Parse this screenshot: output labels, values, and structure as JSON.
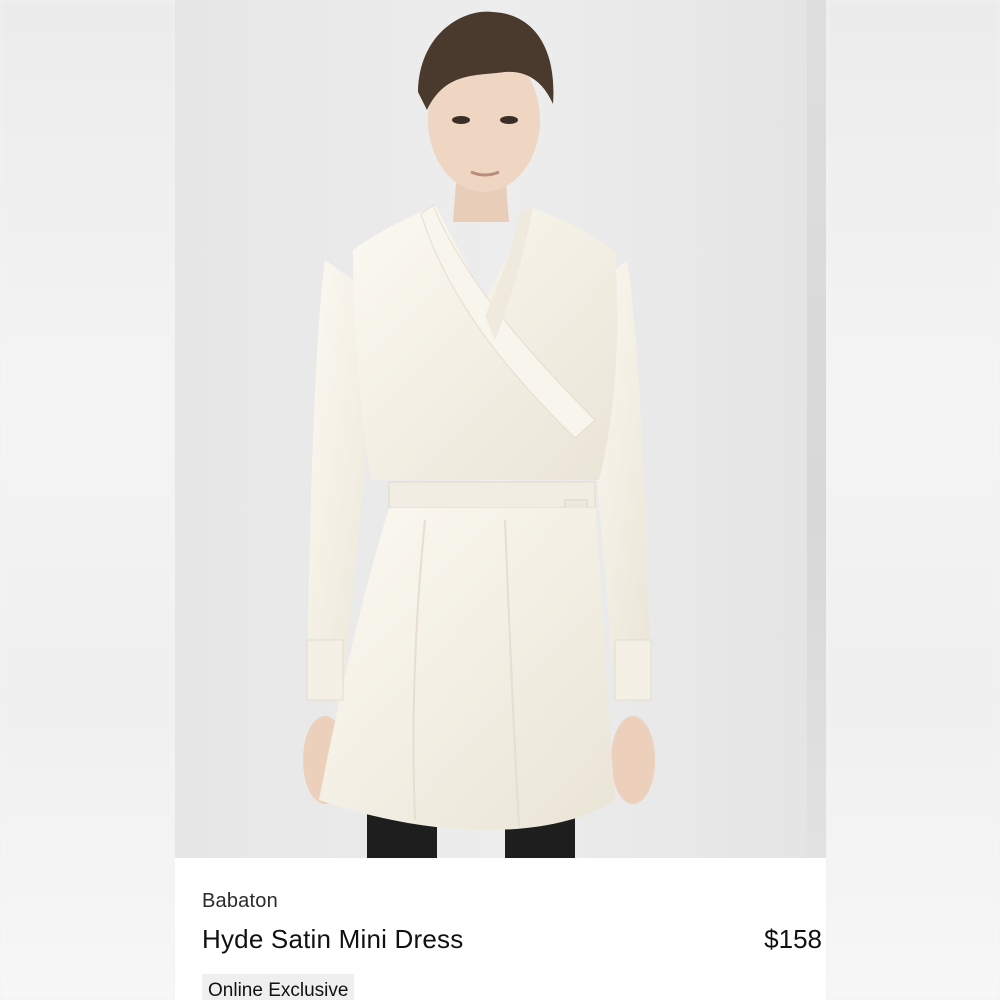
{
  "product": {
    "brand": "Babaton",
    "name": "Hyde Satin Mini Dress",
    "price": "$158",
    "badge": "Online Exclusive",
    "image_alt": "Model wearing ivory satin wrap mini dress"
  },
  "colors": {
    "card_background": "#ffffff",
    "photo_background": "#e9e9e9",
    "dress": "#f6f3ea",
    "badge_background": "#efefef"
  }
}
